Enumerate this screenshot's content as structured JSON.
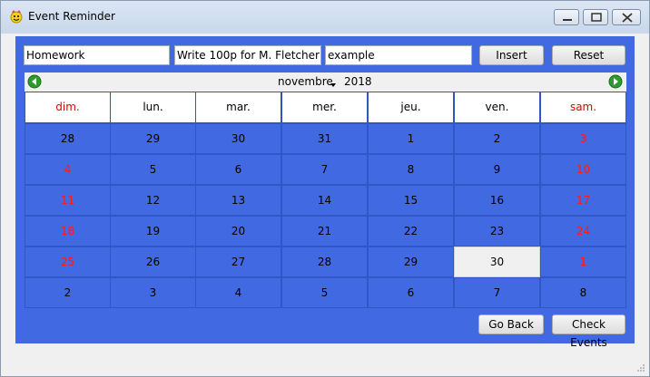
{
  "window": {
    "title": "Event Reminder",
    "icon": "smiley-app-icon"
  },
  "form": {
    "title_value": "Homework",
    "description_value": "Write 100p for M. Fletcher",
    "extra_value": "example",
    "insert_label": "Insert",
    "reset_label": "Reset"
  },
  "calendar": {
    "month": "novembre",
    "year": "2018",
    "day_names": [
      "dim.",
      "lun.",
      "mar.",
      "mer.",
      "jeu.",
      "ven.",
      "sam."
    ],
    "weeks": [
      [
        "28",
        "29",
        "30",
        "31",
        "1",
        "2",
        "3"
      ],
      [
        "4",
        "5",
        "6",
        "7",
        "8",
        "9",
        "10"
      ],
      [
        "11",
        "12",
        "13",
        "14",
        "15",
        "16",
        "17"
      ],
      [
        "18",
        "19",
        "20",
        "21",
        "22",
        "23",
        "24"
      ],
      [
        "25",
        "26",
        "27",
        "28",
        "29",
        "30",
        "1"
      ],
      [
        "2",
        "3",
        "4",
        "5",
        "6",
        "7",
        "8"
      ]
    ],
    "weekend_columns": [
      0,
      6
    ],
    "weekend_color_rows": [
      1,
      2,
      3,
      4
    ],
    "selected": {
      "week": 4,
      "day": 5
    },
    "colors": {
      "background": "#4169e1",
      "weekend": "#ff1a1a",
      "selected": "#f0f0f0"
    }
  },
  "actions": {
    "go_back_label": "Go Back",
    "check_events_label": "Check Events"
  }
}
